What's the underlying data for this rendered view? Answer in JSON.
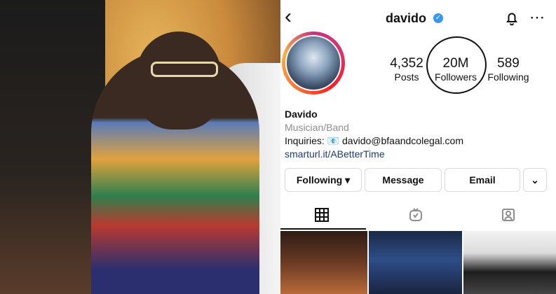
{
  "profile": {
    "username": "davido",
    "stats": [
      {
        "value": "4,352",
        "label": "Posts"
      },
      {
        "value": "20M",
        "label": "Followers"
      },
      {
        "value": "589",
        "label": "Following"
      }
    ],
    "bio": {
      "name": "Davido",
      "category": "Musician/Band",
      "inquiries": "Inquiries: 📧 davido@bfaandcolegal.com",
      "link": "smarturl.it/ABetterTime"
    }
  },
  "buttons": {
    "following": "Following ▾",
    "message": "Message",
    "email": "Email",
    "more": "⌄"
  },
  "icons": {
    "back": "‹",
    "verified": "✓",
    "more": "⋯"
  },
  "colors": {
    "verified": "#3897f0",
    "link": "#1e3a6f",
    "muted": "#8e8e8e"
  }
}
